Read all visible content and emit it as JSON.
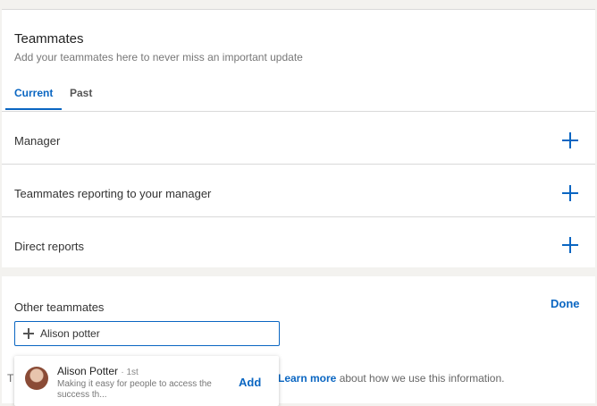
{
  "section": {
    "title": "Teammates",
    "subtitle": "Add your teammates here to never miss an important update"
  },
  "tabs": [
    {
      "label": "Current",
      "active": true
    },
    {
      "label": "Past",
      "active": false
    }
  ],
  "rows": [
    {
      "label": "Manager"
    },
    {
      "label": "Teammates reporting to your manager"
    },
    {
      "label": "Direct reports"
    }
  ],
  "other": {
    "label": "Other teammates",
    "done_label": "Done",
    "search_value": "Alison potter"
  },
  "suggestion": {
    "name": "Alison Potter",
    "degree": "· 1st",
    "headline": "Making it easy for people to access the success th...",
    "add_label": "Add"
  },
  "footer": {
    "prefix": "T",
    "learn_more": "Learn more",
    "suffix": " about how we use this information."
  },
  "colors": {
    "accent": "#0a66c2",
    "background": "#f3f2ef"
  },
  "icons": [
    "plus-icon",
    "plus-icon",
    "plus-icon",
    "plus-icon"
  ]
}
